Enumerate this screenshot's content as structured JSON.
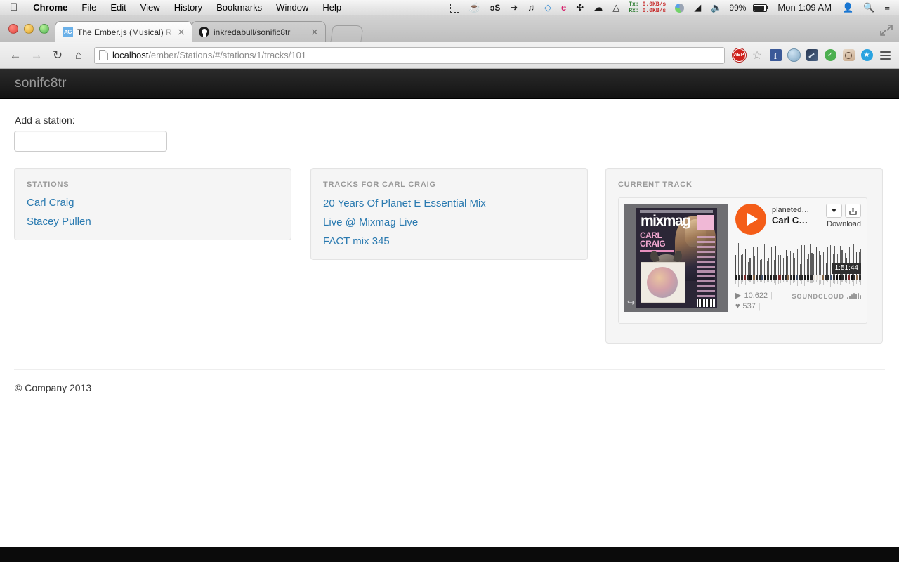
{
  "menubar": {
    "apple_icon": "apple-icon",
    "items": [
      {
        "label": "Chrome",
        "bold": true
      },
      {
        "label": "File",
        "bold": false
      },
      {
        "label": "Edit",
        "bold": false
      },
      {
        "label": "View",
        "bold": false
      },
      {
        "label": "History",
        "bold": false
      },
      {
        "label": "Bookmarks",
        "bold": false
      },
      {
        "label": "Window",
        "bold": false
      },
      {
        "label": "Help",
        "bold": false
      }
    ],
    "status_icons": [
      {
        "name": "screenshot-selection-icon",
        "glyph": ""
      },
      {
        "name": "caffeine-icon",
        "glyph": "☕"
      },
      {
        "name": "lastfm-icon",
        "glyph": "ɔS"
      },
      {
        "name": "flight-mode-icon",
        "glyph": "✈"
      },
      {
        "name": "headphones-icon",
        "glyph": "♫"
      },
      {
        "name": "dropbox-icon",
        "glyph": "✓"
      },
      {
        "name": "evernote-icon",
        "glyph": "e"
      },
      {
        "name": "moom-icon",
        "glyph": "✥"
      },
      {
        "name": "cloud-icon",
        "glyph": "☁"
      },
      {
        "name": "google-drive-icon",
        "glyph": "▲"
      }
    ],
    "network": {
      "tx_label": "Tx:",
      "tx_value": "0.0KB/s",
      "rx_label": "Rx:",
      "rx_value": "0.0KB/s"
    },
    "battery_percent": "99%",
    "clock": "Mon 1:09 AM",
    "user_icon": "user-icon",
    "spotlight_icon": "search-icon",
    "notification_icon": "notification-center-icon"
  },
  "browser": {
    "tabs": [
      {
        "title": "The Ember.js (Musical) ",
        "title_dim": "Ref",
        "favicon": "ember-favicon",
        "active": true
      },
      {
        "title": "inkredabull/sonific8tr",
        "title_dim": "",
        "favicon": "github-favicon",
        "active": false
      }
    ],
    "new_tab_label": "new-tab-button",
    "fullscreen_label": "fullscreen-button",
    "toolbar": {
      "back_icon": "back-arrow-icon",
      "forward_icon": "forward-arrow-icon",
      "reload_icon": "reload-icon",
      "home_icon": "home-icon",
      "url_host": "localhost",
      "url_path": "/ember/Stations/#/stations/1/tracks/101",
      "url_full": "localhost/ember/Stations/#/stations/1/tracks/101",
      "extensions": [
        {
          "name": "adblock-plus-icon",
          "label": "ABP"
        },
        {
          "name": "bookmark-star-icon",
          "label": "☆"
        },
        {
          "name": "facebook-icon",
          "label": "f"
        },
        {
          "name": "globe-icon",
          "label": ""
        },
        {
          "name": "speedtest-icon",
          "label": ""
        },
        {
          "name": "evernote-web-clipper-icon",
          "label": "e"
        },
        {
          "name": "instagram-icon",
          "label": ""
        },
        {
          "name": "pocket-star-icon",
          "label": "★"
        },
        {
          "name": "chrome-menu-icon",
          "label": ""
        }
      ]
    }
  },
  "page": {
    "brand": "sonifc8tr",
    "add_station": {
      "label": "Add a station:",
      "value": "",
      "placeholder": ""
    },
    "stations_panel": {
      "title": "STATIONS",
      "items": [
        "Carl Craig",
        "Stacey Pullen"
      ]
    },
    "tracks_panel": {
      "title": "TRACKS FOR CARL CRAIG",
      "items": [
        "20 Years Of Planet E Essential Mix",
        "Live @ Mixmag Live",
        "FACT mix 345"
      ]
    },
    "current_track_panel": {
      "title": "CURRENT TRACK",
      "artwork": {
        "name": "mixmag-carl-craig-artwork",
        "magazine": "mixmag",
        "headline_line1": "CARL",
        "headline_line2": "CRAIG",
        "tagline": "THE WORLD'S BIGGEST DANCE MUSIC AND CLUBBING MAGAZINE"
      },
      "player": {
        "play_button": "play-button",
        "username": "planeted…",
        "track_title": "Carl C…",
        "like_button": "♥",
        "share_button": "↪",
        "download_label": "Download",
        "duration": "1:51:44",
        "play_count": "10,622",
        "like_count": "537",
        "brand": "SOUNDCLOUD"
      }
    },
    "footer": {
      "copyright": "© Company 2013"
    }
  },
  "colors": {
    "soundcloud_orange": "#f45d18",
    "link_blue": "#2a7ab0",
    "navbar_dark": "#131313",
    "panel_bg": "#f5f5f5",
    "panel_border": "#e3e3e3",
    "muted_text": "#999999"
  }
}
